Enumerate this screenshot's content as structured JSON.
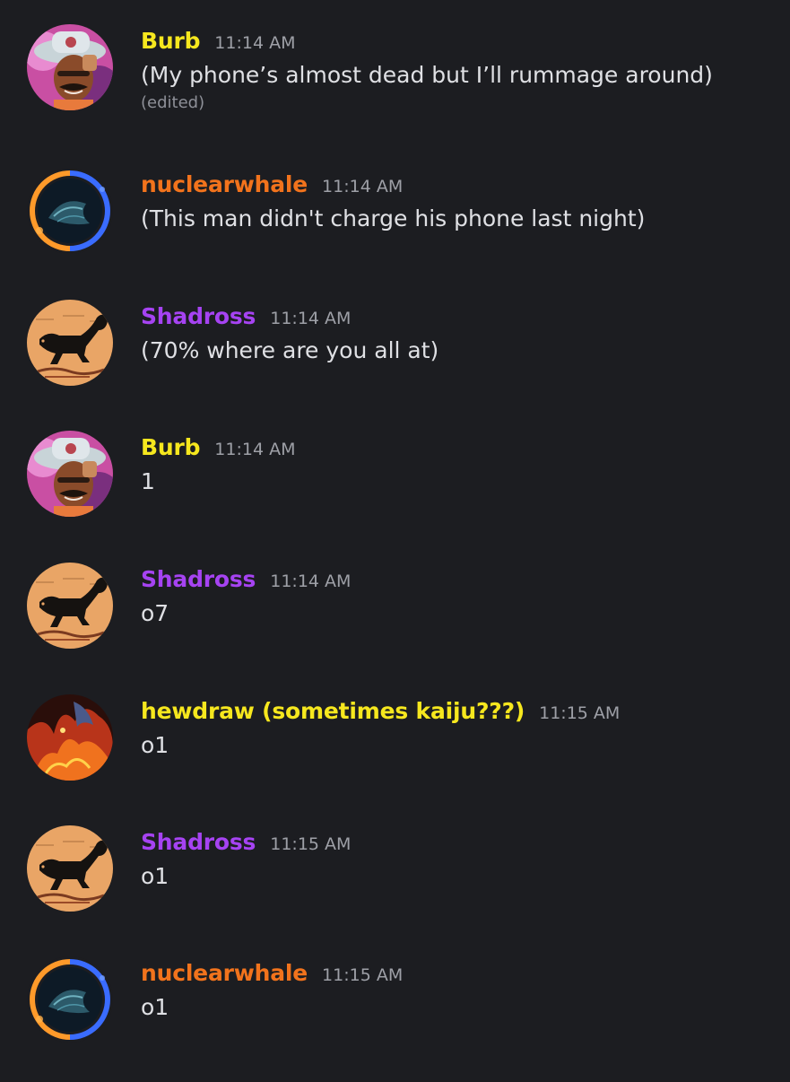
{
  "colors": {
    "background": "#1c1d21",
    "text": "#dfe0e4",
    "timestamp": "#9ea0a7"
  },
  "messages": [
    {
      "user": "Burb",
      "user_color": "#f6e71e",
      "avatar_icon": "cowboy-hat-man-avatar-icon",
      "time": "11:14 AM",
      "text": "(My phone’s almost dead but I’ll rummage around)",
      "edited": "(edited)"
    },
    {
      "user": "nuclearwhale",
      "user_color": "#f2731c",
      "avatar_icon": "glowing-ring-avatar-icon",
      "time": "11:14 AM",
      "text": "(This man didn't charge his phone last night)"
    },
    {
      "user": "Shadross",
      "user_color": "#a643f2",
      "avatar_icon": "black-lizard-avatar-icon",
      "time": "11:14 AM",
      "text": "(70% where are you all at)"
    },
    {
      "user": "Burb",
      "user_color": "#f6e71e",
      "avatar_icon": "cowboy-hat-man-avatar-icon",
      "time": "11:14 AM",
      "text": "1"
    },
    {
      "user": "Shadross",
      "user_color": "#a643f2",
      "avatar_icon": "black-lizard-avatar-icon",
      "time": "11:14 AM",
      "text": "o7"
    },
    {
      "user": "hewdraw (sometimes kaiju???)",
      "user_color": "#f6e71e",
      "avatar_icon": "fiery-creature-avatar-icon",
      "time": "11:15 AM",
      "text": "o1"
    },
    {
      "user": "Shadross",
      "user_color": "#a643f2",
      "avatar_icon": "black-lizard-avatar-icon",
      "time": "11:15 AM",
      "text": "o1"
    },
    {
      "user": "nuclearwhale",
      "user_color": "#f2731c",
      "avatar_icon": "glowing-ring-avatar-icon",
      "time": "11:15 AM",
      "text": "o1"
    }
  ]
}
